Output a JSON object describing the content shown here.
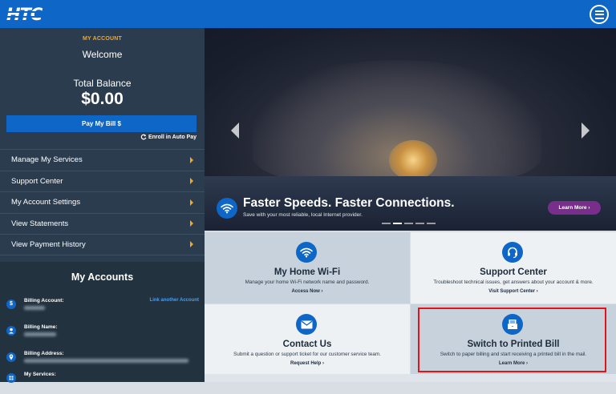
{
  "header": {
    "logo_text": "HTC"
  },
  "sidebar": {
    "section_label": "MY ACCOUNT",
    "welcome": "Welcome",
    "total_balance_label": "Total Balance",
    "total_balance_value": "$0.00",
    "pay_button": "Pay My Bill $",
    "autopay_link": "Enroll in Auto Pay",
    "nav": [
      {
        "label": "Manage My Services"
      },
      {
        "label": "Support Center"
      },
      {
        "label": "My Account Settings"
      },
      {
        "label": "View Statements"
      },
      {
        "label": "View Payment History"
      }
    ],
    "accounts": {
      "title": "My Accounts",
      "link_another": "Link another Account",
      "rows": [
        {
          "label": "Billing Account:",
          "icon": "dollar-icon"
        },
        {
          "label": "Billing Name:",
          "icon": "person-icon"
        },
        {
          "label": "Billing Address:",
          "icon": "location-pin-icon"
        },
        {
          "label": "My Services:",
          "icon": "services-icon"
        }
      ]
    }
  },
  "hero": {
    "title": "Faster Speeds. Faster Connections.",
    "subtitle": "Save with your most reliable, local Internet provider.",
    "button": "Learn More",
    "slides": 5,
    "active_slide": 2
  },
  "tiles": [
    {
      "title": "My Home Wi-Fi",
      "desc": "Manage your home Wi-Fi network name and password.",
      "link": "Access Now",
      "icon": "wifi-icon"
    },
    {
      "title": "Support Center",
      "desc": "Troubleshoot technical issues, get answers about your account & more.",
      "link": "Visit Support Center",
      "icon": "headset-icon"
    },
    {
      "title": "Contact Us",
      "desc": "Submit a question or support ticket for our customer service team.",
      "link": "Request Help",
      "icon": "envelope-icon"
    },
    {
      "title": "Switch to Printed Bill",
      "desc": "Switch to paper billing and start receiving a printed bill in the mail.",
      "link": "Learn More",
      "icon": "mail-bill-icon"
    }
  ],
  "colors": {
    "brand_blue": "#0e66c6",
    "accent_orange": "#f5a623",
    "cta_purple": "#7a2e8c",
    "highlight_red": "#e3131c"
  }
}
